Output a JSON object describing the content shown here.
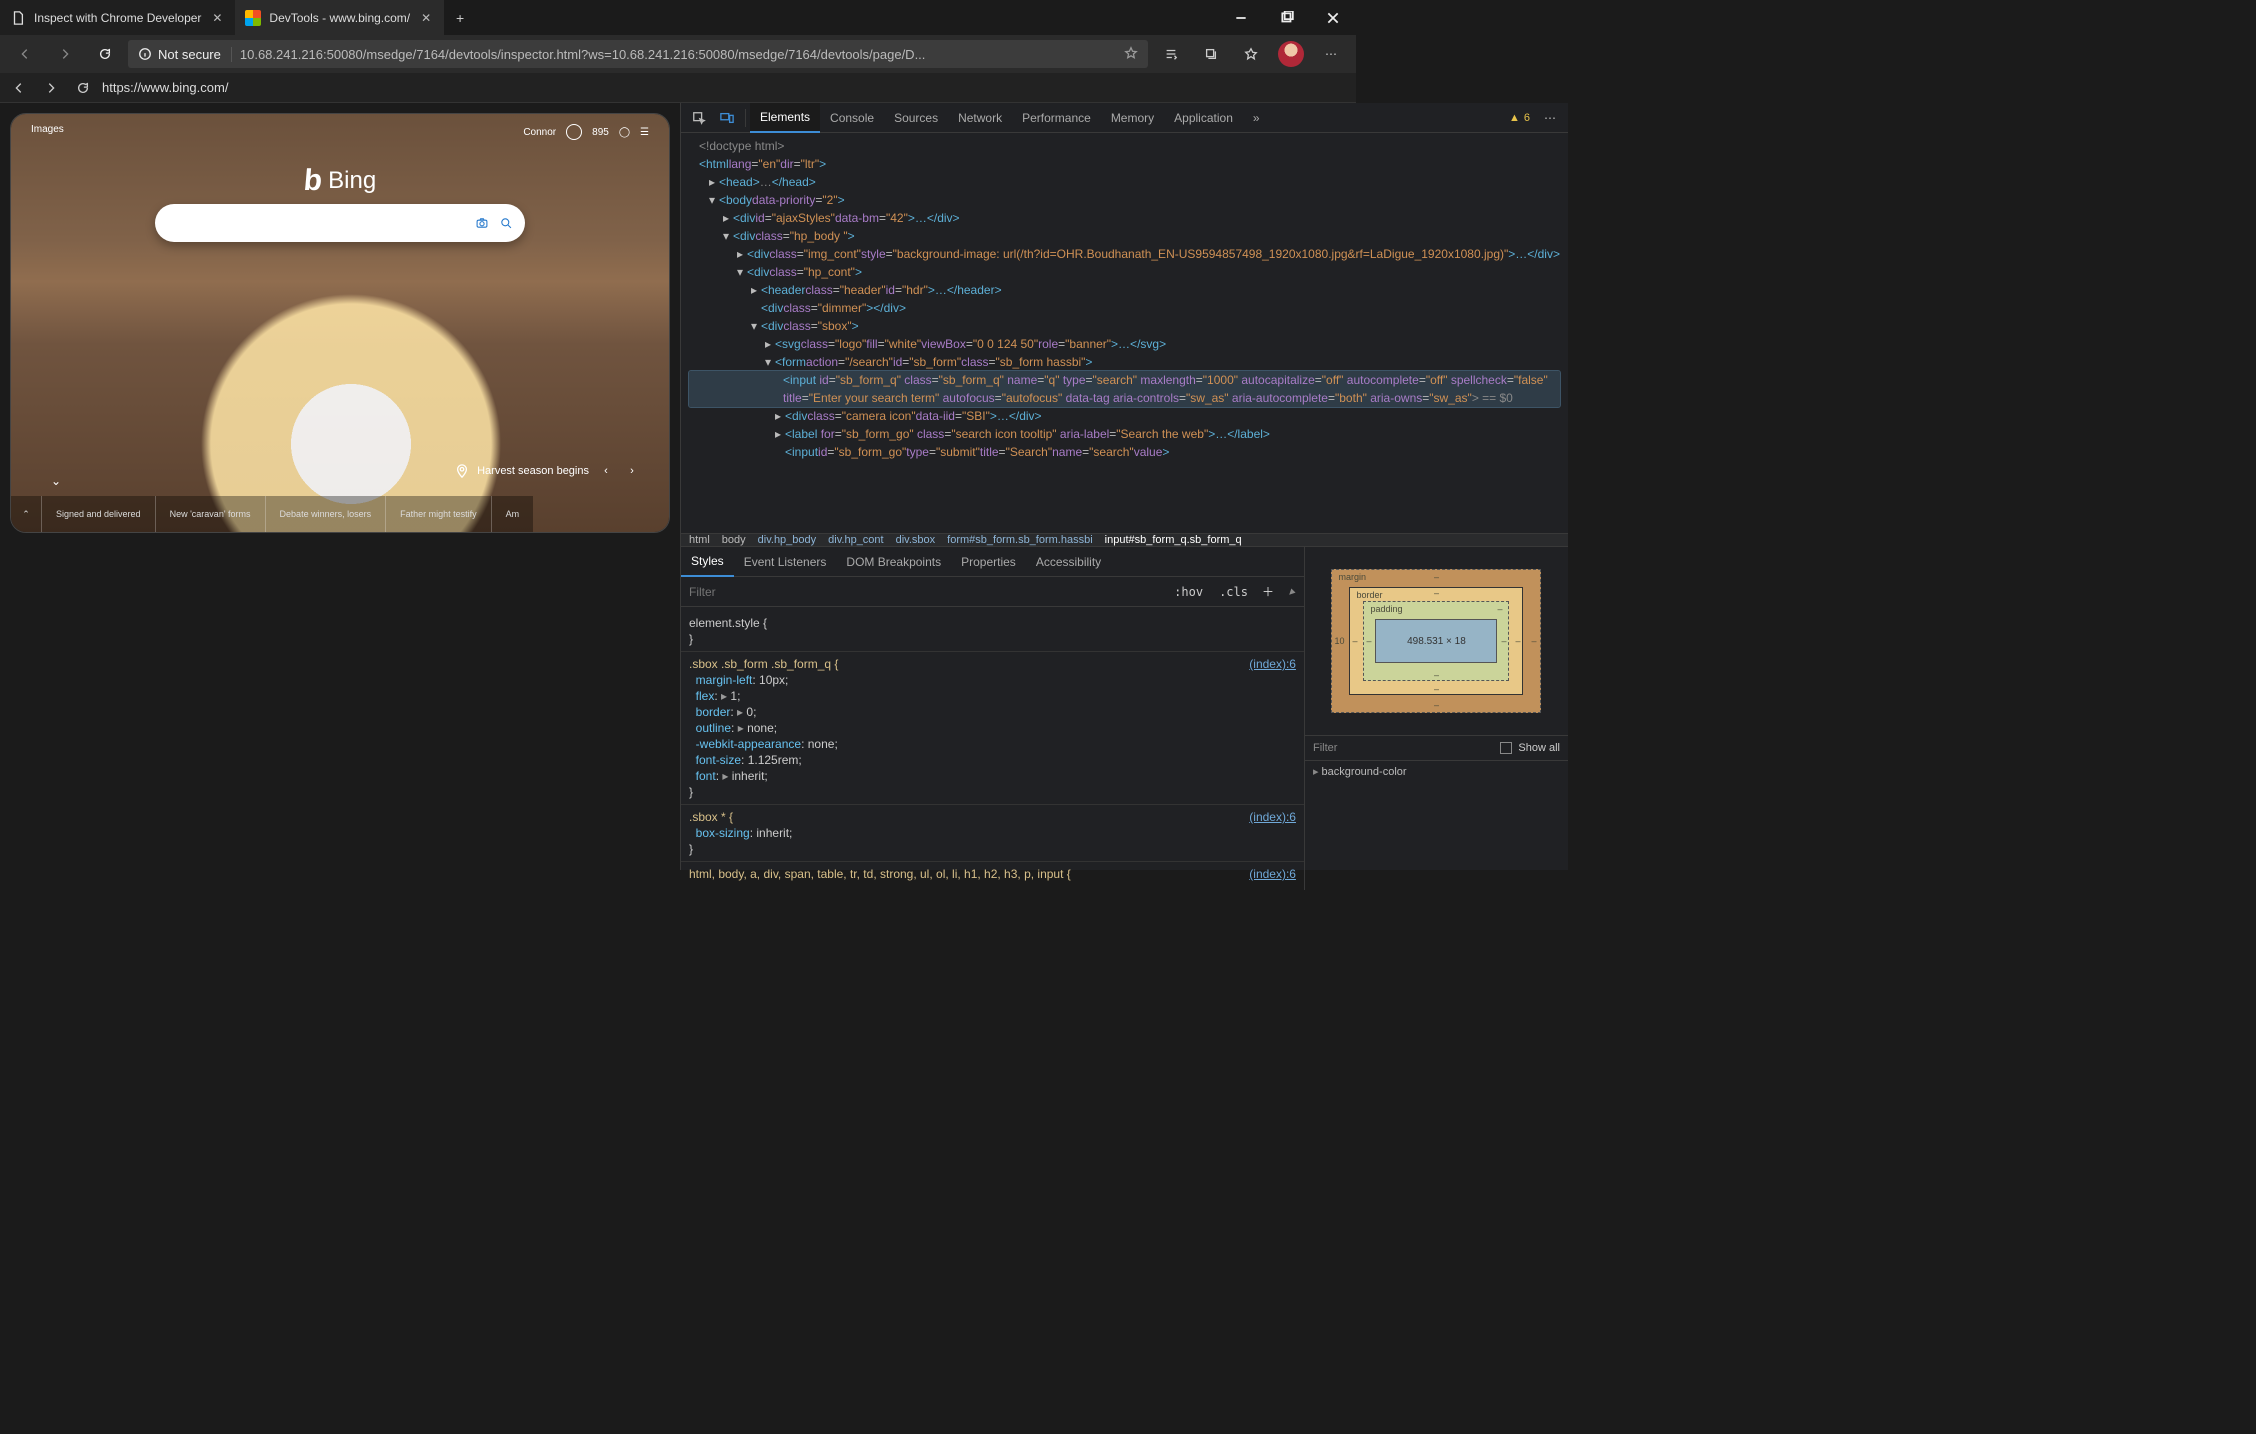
{
  "window": {
    "tabs": [
      {
        "title": "Inspect with Chrome Developer",
        "active": false
      },
      {
        "title": "DevTools - www.bing.com/",
        "active": true
      }
    ],
    "newtab": "+"
  },
  "addressbar": {
    "not_secure": "Not secure",
    "url": "10.68.241.216:50080/msedge/7164/devtools/inspector.html?ws=10.68.241.216:50080/msedge/7164/devtools/page/D..."
  },
  "subaddress": {
    "url": "https://www.bing.com/"
  },
  "bing_preview": {
    "nav_left": "Images",
    "user": "Connor",
    "points": "895",
    "logo_text": "Bing",
    "caption": "Harvest season begins",
    "news": [
      "Signed and delivered",
      "New 'caravan' forms",
      "Debate winners, losers",
      "Father might testify",
      "Am"
    ]
  },
  "devtools_tabs": [
    "Elements",
    "Console",
    "Sources",
    "Network",
    "Performance",
    "Memory",
    "Application"
  ],
  "devtools_tabs_warn": "6",
  "dom_tree": {
    "l0": "<!doctype html>",
    "l1a": "<html ",
    "l1b": "lang",
    "l1c": "\"en\"",
    "l1d": "dir",
    "l1e": "\"ltr\"",
    "l1f": ">",
    "l2a": "<head>",
    "l2b": "…",
    "l2c": "</head>",
    "l3a": "<body ",
    "l3b": "data-priority",
    "l3c": "\"2\"",
    "l3d": ">",
    "l4a": "<div ",
    "l4b": "id",
    "l4c": "\"ajaxStyles\"",
    "l4d": "data-bm",
    "l4e": "\"42\"",
    "l4f": ">…</div>",
    "l5a": "<div ",
    "l5b": "class",
    "l5c": "\"hp_body \"",
    "l5d": ">",
    "l6a": "<div ",
    "l6b": "class",
    "l6c": "\"img_cont\"",
    "l6d": "style",
    "l6e": "\"background-image: url(/th?id=OHR.Boudhanath_EN-US9594857498_1920x1080.jpg&rf=LaDigue_1920x1080.jpg)\"",
    "l6f": ">…</div>",
    "l7a": "<div ",
    "l7b": "class",
    "l7c": "\"hp_cont\"",
    "l7d": ">",
    "l8a": "<header ",
    "l8b": "class",
    "l8c": "\"header\"",
    "l8d": "id",
    "l8e": "\"hdr\"",
    "l8f": ">…</header>",
    "l9a": "<div ",
    "l9b": "class",
    "l9c": "\"dimmer\"",
    "l9d": "></div>",
    "l10a": "<div ",
    "l10b": "class",
    "l10c": "\"sbox\"",
    "l10d": ">",
    "l11a": "<svg ",
    "l11b": "class",
    "l11c": "\"logo\"",
    "l11d": "fill",
    "l11e": "\"white\"",
    "l11f": "viewBox",
    "l11g": "\"0 0 124 50\"",
    "l11h": "role",
    "l11i": "\"banner\"",
    "l11j": ">…</svg>",
    "l12a": "<form ",
    "l12b": "action",
    "l12c": "\"/search\"",
    "l12d": "id",
    "l12e": "\"sb_form\"",
    "l12f": "class",
    "l12g": "\"sb_form hassbi\"",
    "l12h": ">",
    "l13a": "<input ",
    "l13b": "id",
    "l13c": "\"sb_form_q\"",
    "l13d": "class",
    "l13e": "\"sb_form_q\"",
    "l13f": "name",
    "l13g": "\"q\"",
    "l13h": "type",
    "l13i": "\"search\"",
    "l13j": "maxlength",
    "l13k": "\"1000\"",
    "l13l": "autocapitalize",
    "l13m": "\"off\"",
    "l13n": "autocomplete",
    "l13o": "\"off\"",
    "l13p": "spellcheck",
    "l13q": "\"false\"",
    "l13r": "title",
    "l13s": "\"Enter your search term\"",
    "l13t": "autofocus",
    "l13u": "\"autofocus\"",
    "l13v": "data-tag",
    "l13w": "aria-controls",
    "l13x": "\"sw_as\"",
    "l13y": "aria-autocomplete",
    "l13z": "\"both\"",
    "l13aa": "aria-owns",
    "l13ab": "\"sw_as\"",
    "l13ac": "> == $0",
    "l14a": "<div ",
    "l14b": "class",
    "l14c": "\"camera icon\"",
    "l14d": "data-iid",
    "l14e": "\"SBI\"",
    "l14f": ">…</div>",
    "l15a": "<label ",
    "l15b": "for",
    "l15c": "\"sb_form_go\"",
    "l15d": "class",
    "l15e": "\"search icon tooltip\"",
    "l15f": "aria-label",
    "l15g": "\"Search the web\"",
    "l15h": ">…</label>",
    "l16a": "<input ",
    "l16b": "id",
    "l16c": "\"sb_form_go\"",
    "l16d": "type",
    "l16e": "\"submit\"",
    "l16f": "title",
    "l16g": "\"Search\"",
    "l16h": "name",
    "l16i": "\"search\"",
    "l16j": "value",
    "l16k": ">"
  },
  "crumbs": [
    "html",
    "body",
    "div.hp_body",
    "div.hp_cont",
    "div.sbox",
    "form#sb_form.sb_form.hassbi",
    "input#sb_form_q.sb_form_q"
  ],
  "styles_tabs": [
    "Styles",
    "Event Listeners",
    "DOM Breakpoints",
    "Properties",
    "Accessibility"
  ],
  "filter_placeholder": "Filter",
  "hov": ":hov",
  "cls": ".cls",
  "rules": {
    "r0": "element.style {",
    "r0b": "}",
    "r1sel": ".sbox .sb_form .sb_form_q {",
    "r1p1": "margin-left",
    "r1v1": "10px;",
    "r1p2": "flex",
    "r1v2": "1;",
    "r1p3": "border",
    "r1v3": "0;",
    "r1p4": "outline",
    "r1v4": "none;",
    "r1p5": "-webkit-appearance",
    "r1v5": "none;",
    "r1p6": "font-size",
    "r1v6": "1.125rem;",
    "r1p7": "font",
    "r1v7": "inherit;",
    "r1end": "}",
    "r2sel": ".sbox * {",
    "r2p1": "box-sizing",
    "r2v1": "inherit;",
    "r2end": "}",
    "r3sel": "html, body, a, div, span, table, tr, td, strong, ul, ol, li, h1, h2, h3, p, input {",
    "srclink": "(index):6"
  },
  "boxmodel": {
    "margin": "margin",
    "border": "border",
    "padding": "padding",
    "dim": "498.531 × 18",
    "ml": "10",
    "dash": "–"
  },
  "computed": {
    "filter": "Filter",
    "showall": "Show all",
    "bgcolor": "background-color"
  }
}
